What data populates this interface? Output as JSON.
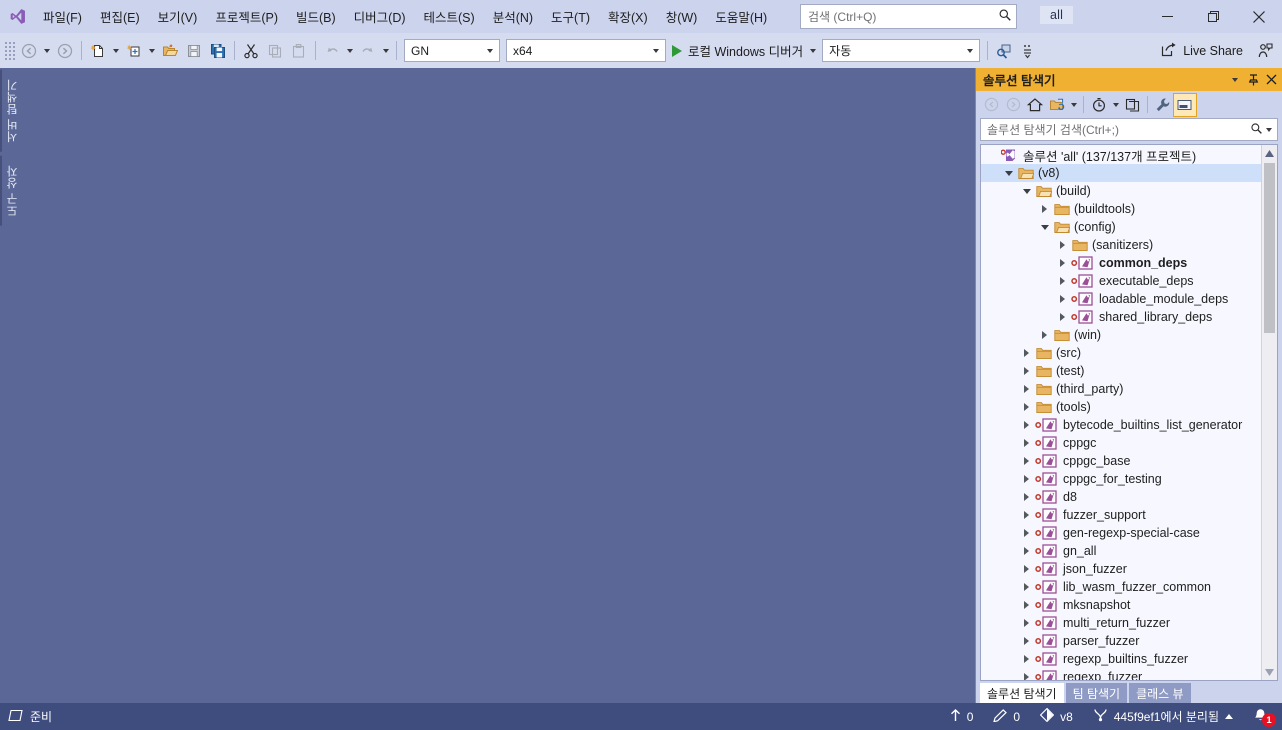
{
  "titlebar": {
    "logo_icon": "visual-studio-logo",
    "menus": [
      "파일(F)",
      "편집(E)",
      "보기(V)",
      "프로젝트(P)",
      "빌드(B)",
      "디버그(D)",
      "테스트(S)",
      "분석(N)",
      "도구(T)",
      "확장(X)",
      "창(W)",
      "도움말(H)"
    ],
    "search_placeholder": "검색 (Ctrl+Q)",
    "search_icon": "magnifier-icon",
    "app_title": "all",
    "minimize_label": "최소화",
    "restore_label": "이전 크기로 복원",
    "close_label": "닫기"
  },
  "toolbar": {
    "back_icon": "navigate-back-icon",
    "forward_icon": "navigate-forward-icon",
    "new_file_icon": "new-file-icon",
    "new_project_icon": "new-project-icon",
    "open_folder_icon": "open-folder-icon",
    "save_icon": "save-icon",
    "save_all_icon": "save-all-icon",
    "cut_icon": "cut-icon",
    "copy_icon": "copy-icon",
    "paste_icon": "paste-icon",
    "undo_icon": "undo-icon",
    "redo_icon": "redo-icon",
    "configuration": "GN",
    "platform": "x64",
    "run_label": "로컬 Windows 디버거",
    "run_icon": "play-icon",
    "hot_reload": "자동",
    "find_icon": "find-in-files-icon",
    "options_icon": "toolbar-options-icon",
    "live_share_label": "Live Share",
    "live_share_icon": "share-icon",
    "feedback_icon": "send-feedback-icon"
  },
  "left_rail": {
    "tabs": [
      "서버 탐색기",
      "도구 상자"
    ]
  },
  "solution_explorer": {
    "title": "솔루션 탐색기",
    "title_dropdown_icon": "chevron-down-icon",
    "pin_icon": "pin-icon",
    "close_icon": "close-icon",
    "toolbar": {
      "back_icon": "back-icon",
      "forward_icon": "forward-icon",
      "home_icon": "home-icon",
      "new_folder_icon": "sync-with-active-document-icon",
      "pending_changes_icon": "pending-changes-filter-icon",
      "collapse_all_icon": "collapse-all-icon",
      "properties_icon": "properties-wrench-icon",
      "preview_selected_icon": "preview-selected-items-icon"
    },
    "search_placeholder": "솔루션 탐색기 검색(Ctrl+;)",
    "search_icon": "magnifier-icon",
    "search_dropdown_icon": "chevron-down-icon",
    "tree": [
      {
        "label": "솔루션 'all' (137/137개 프로젝트)",
        "indent": 0,
        "expander": "none",
        "icon": "solution-icon",
        "selected": false,
        "bold": false
      },
      {
        "label": "(v8)",
        "indent": 1,
        "expander": "open",
        "icon": "folder-open",
        "selected": true,
        "bold": false
      },
      {
        "label": "(build)",
        "indent": 2,
        "expander": "open",
        "icon": "folder-open",
        "selected": false,
        "bold": false
      },
      {
        "label": "(buildtools)",
        "indent": 3,
        "expander": "closed",
        "icon": "folder-closed",
        "selected": false,
        "bold": false
      },
      {
        "label": "(config)",
        "indent": 3,
        "expander": "open",
        "icon": "folder-open",
        "selected": false,
        "bold": false
      },
      {
        "label": "(sanitizers)",
        "indent": 4,
        "expander": "closed",
        "icon": "folder-closed",
        "selected": false,
        "bold": false
      },
      {
        "label": "common_deps",
        "indent": 4,
        "expander": "closed",
        "icon": "project-icon",
        "selected": false,
        "bold": true
      },
      {
        "label": "executable_deps",
        "indent": 4,
        "expander": "closed",
        "icon": "project-icon",
        "selected": false,
        "bold": false
      },
      {
        "label": "loadable_module_deps",
        "indent": 4,
        "expander": "closed",
        "icon": "project-icon",
        "selected": false,
        "bold": false
      },
      {
        "label": "shared_library_deps",
        "indent": 4,
        "expander": "closed",
        "icon": "project-icon",
        "selected": false,
        "bold": false
      },
      {
        "label": "(win)",
        "indent": 3,
        "expander": "closed",
        "icon": "folder-closed",
        "selected": false,
        "bold": false
      },
      {
        "label": "(src)",
        "indent": 2,
        "expander": "closed",
        "icon": "folder-closed",
        "selected": false,
        "bold": false
      },
      {
        "label": "(test)",
        "indent": 2,
        "expander": "closed",
        "icon": "folder-closed",
        "selected": false,
        "bold": false
      },
      {
        "label": "(third_party)",
        "indent": 2,
        "expander": "closed",
        "icon": "folder-closed",
        "selected": false,
        "bold": false
      },
      {
        "label": "(tools)",
        "indent": 2,
        "expander": "closed",
        "icon": "folder-closed",
        "selected": false,
        "bold": false
      },
      {
        "label": "bytecode_builtins_list_generator",
        "indent": 2,
        "expander": "closed",
        "icon": "project-icon",
        "selected": false,
        "bold": false
      },
      {
        "label": "cppgc",
        "indent": 2,
        "expander": "closed",
        "icon": "project-icon",
        "selected": false,
        "bold": false
      },
      {
        "label": "cppgc_base",
        "indent": 2,
        "expander": "closed",
        "icon": "project-icon",
        "selected": false,
        "bold": false
      },
      {
        "label": "cppgc_for_testing",
        "indent": 2,
        "expander": "closed",
        "icon": "project-icon",
        "selected": false,
        "bold": false
      },
      {
        "label": "d8",
        "indent": 2,
        "expander": "closed",
        "icon": "project-icon",
        "selected": false,
        "bold": false
      },
      {
        "label": "fuzzer_support",
        "indent": 2,
        "expander": "closed",
        "icon": "project-icon",
        "selected": false,
        "bold": false
      },
      {
        "label": "gen-regexp-special-case",
        "indent": 2,
        "expander": "closed",
        "icon": "project-icon",
        "selected": false,
        "bold": false
      },
      {
        "label": "gn_all",
        "indent": 2,
        "expander": "closed",
        "icon": "project-icon",
        "selected": false,
        "bold": false
      },
      {
        "label": "json_fuzzer",
        "indent": 2,
        "expander": "closed",
        "icon": "project-icon",
        "selected": false,
        "bold": false
      },
      {
        "label": "lib_wasm_fuzzer_common",
        "indent": 2,
        "expander": "closed",
        "icon": "project-icon",
        "selected": false,
        "bold": false
      },
      {
        "label": "mksnapshot",
        "indent": 2,
        "expander": "closed",
        "icon": "project-icon",
        "selected": false,
        "bold": false
      },
      {
        "label": "multi_return_fuzzer",
        "indent": 2,
        "expander": "closed",
        "icon": "project-icon",
        "selected": false,
        "bold": false
      },
      {
        "label": "parser_fuzzer",
        "indent": 2,
        "expander": "closed",
        "icon": "project-icon",
        "selected": false,
        "bold": false
      },
      {
        "label": "regexp_builtins_fuzzer",
        "indent": 2,
        "expander": "closed",
        "icon": "project-icon",
        "selected": false,
        "bold": false
      },
      {
        "label": "regexp_fuzzer",
        "indent": 2,
        "expander": "closed",
        "icon": "project-icon",
        "selected": false,
        "bold": false
      }
    ],
    "scroll_up_icon": "scroll-up-icon",
    "scroll_down_icon": "scroll-down-icon",
    "tabs": [
      {
        "label": "솔루션 탐색기",
        "active": true
      },
      {
        "label": "팀 탐색기",
        "active": false
      },
      {
        "label": "클래스 뷰",
        "active": false
      }
    ]
  },
  "statusbar": {
    "ready_icon": "ready-state-icon",
    "ready_text": "준비",
    "publish_icon": "up-arrow-icon",
    "publish_count": "0",
    "edits_icon": "pencil-icon",
    "edits_count": "0",
    "repo_icon": "source-control-icon",
    "repo_name": "v8",
    "branch_icon": "branch-icon",
    "branch_name": "445f9ef1에서 분리됨",
    "branch_caret_icon": "caret-up-icon",
    "notify_icon": "bell-icon",
    "notify_count": "1"
  },
  "colors": {
    "titlebar_bg": "#ccd3ec",
    "toolbar_bg": "#d6dcf0",
    "workspace_bg": "#5b6897",
    "panel_title_active": "#f0b132",
    "tree_bg": "#f7f8ff",
    "tree_selection": "#cedffa",
    "statusbar_bg": "#3f4c7e",
    "notification_badge": "#e81123",
    "run_arrow_green": "#2e9a37",
    "project_icon_purple": "#9b4f96"
  }
}
